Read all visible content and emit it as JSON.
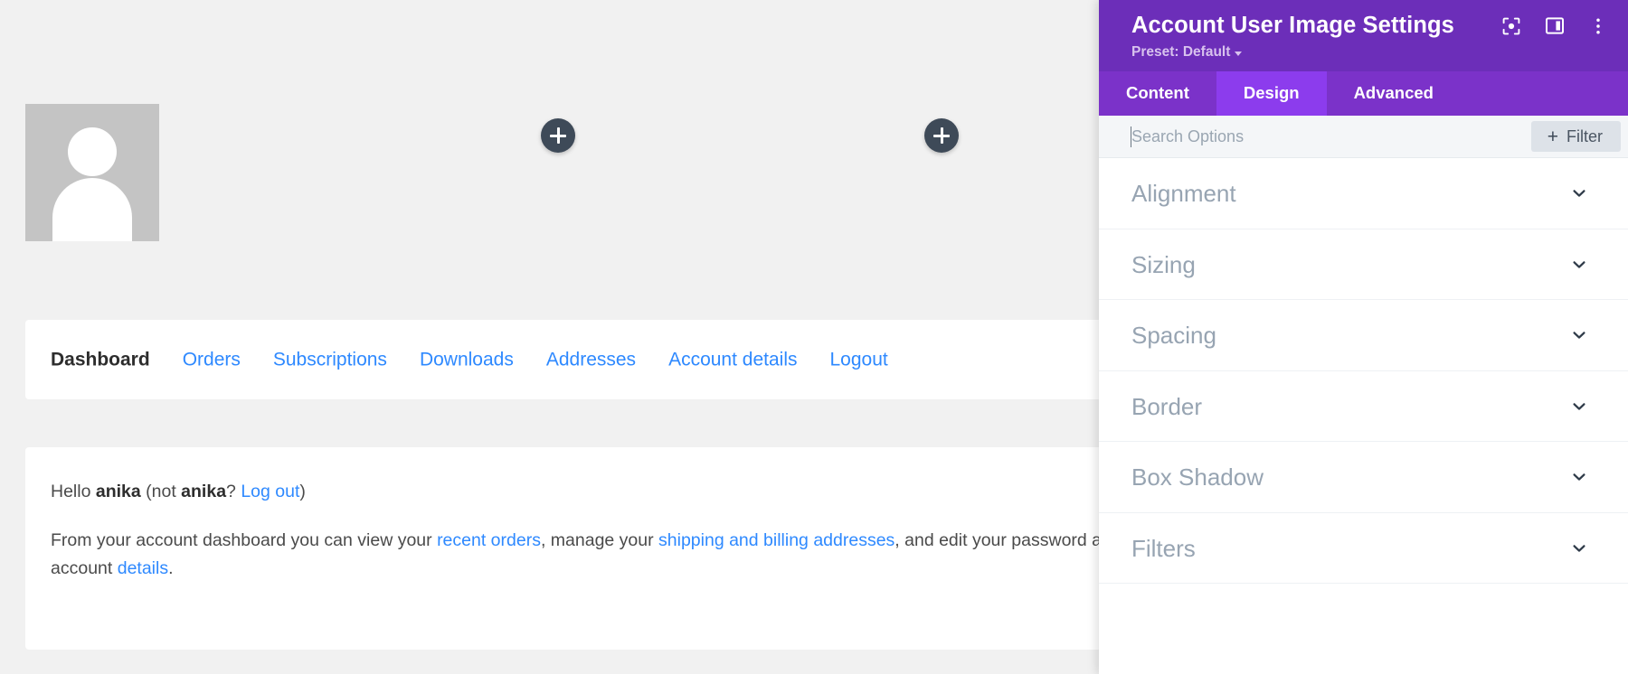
{
  "page_preview": {
    "avatar_alt": "user-avatar-placeholder",
    "add_buttons": [
      "+",
      "+"
    ],
    "nav": {
      "items": [
        {
          "label": "Dashboard",
          "current": true
        },
        {
          "label": "Orders",
          "current": false
        },
        {
          "label": "Subscriptions",
          "current": false
        },
        {
          "label": "Downloads",
          "current": false
        },
        {
          "label": "Addresses",
          "current": false
        },
        {
          "label": "Account details",
          "current": false
        },
        {
          "label": "Logout",
          "current": false
        }
      ]
    },
    "greeting": {
      "hello": "Hello ",
      "user_bold": "anika",
      "not_open": " (not ",
      "not_user_bold": "anika",
      "question": "? ",
      "logout_link": "Log out",
      "close": ")"
    },
    "body": {
      "seg1": "From your account dashboard you can view your ",
      "link1": "recent orders",
      "seg2": ", manage your ",
      "link2": "shipping and billing addresses",
      "seg3": ", and edit your password and account ",
      "link3": "details",
      "seg4": "."
    },
    "colors": {
      "link": "#2e89ff",
      "canvas": "#f1f1f1",
      "card": "#ffffff",
      "add_button": "#3e4a58"
    }
  },
  "settings_panel": {
    "title": "Account User Image Settings",
    "preset_label": "Preset: Default",
    "header_icons": [
      {
        "name": "focus-target-icon"
      },
      {
        "name": "layout-panel-icon"
      },
      {
        "name": "more-vertical-icon"
      }
    ],
    "tabs": [
      {
        "label": "Content",
        "active": false
      },
      {
        "label": "Design",
        "active": true
      },
      {
        "label": "Advanced",
        "active": false
      }
    ],
    "search": {
      "value": "",
      "placeholder": "Search Options"
    },
    "filter_button": {
      "plus": "+",
      "label": "Filter"
    },
    "sections": [
      {
        "label": "Alignment"
      },
      {
        "label": "Sizing"
      },
      {
        "label": "Spacing"
      },
      {
        "label": "Border"
      },
      {
        "label": "Box Shadow"
      },
      {
        "label": "Filters"
      }
    ],
    "colors": {
      "header_bg": "#6c2eb9",
      "tabbar_bg": "#7b32c9",
      "tab_active_bg": "#8c3ced",
      "search_bg": "#f4f6f8",
      "section_label": "#97a4b2"
    }
  }
}
